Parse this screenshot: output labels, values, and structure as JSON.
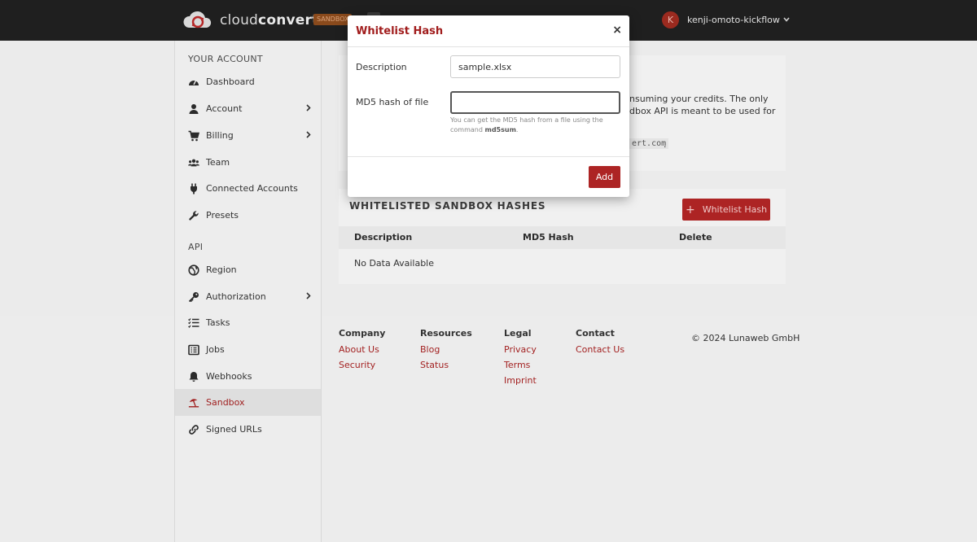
{
  "navbar": {
    "brand_light": "cloud",
    "brand_bold": "convert",
    "env_badge": "SANDBOX",
    "user_initial": "K",
    "username": "kenji-omoto-kickflow"
  },
  "sidebar": {
    "account_heading": "YOUR ACCOUNT",
    "account_items": [
      {
        "label": "Dashboard",
        "icon": "dashboard-icon"
      },
      {
        "label": "Account",
        "icon": "user-icon"
      },
      {
        "label": "Billing",
        "icon": "cart-icon"
      },
      {
        "label": "Team",
        "icon": "team-icon"
      },
      {
        "label": "Connected Accounts",
        "icon": "plug-icon"
      },
      {
        "label": "Presets",
        "icon": "wrench-icon"
      }
    ],
    "api_heading": "API",
    "api_items": [
      {
        "label": "Region",
        "icon": "globe-icon"
      },
      {
        "label": "Authorization",
        "icon": "key-icon"
      },
      {
        "label": "Tasks",
        "icon": "tasks-icon"
      },
      {
        "label": "Jobs",
        "icon": "jobs-icon"
      },
      {
        "label": "Webhooks",
        "icon": "bell-icon"
      },
      {
        "label": "Sandbox",
        "icon": "umbrella-beach-icon",
        "active": true
      },
      {
        "label": "Signed URLs",
        "icon": "link-icon"
      }
    ]
  },
  "main": {
    "intro_line1": "nsuming your credits. The only",
    "intro_line2": "dbox API is meant to be used for",
    "intro_code": "ert.com",
    "intro_period": ".",
    "hashes_title": "WHITELISTED SANDBOX HASHES",
    "whitelist_button": "Whitelist Hash",
    "table": {
      "columns": [
        "Description",
        "MD5 Hash",
        "Delete"
      ],
      "empty_text": "No Data Available"
    }
  },
  "footer": {
    "columns": [
      {
        "heading": "Company",
        "links": [
          "About Us",
          "Security"
        ]
      },
      {
        "heading": "Resources",
        "links": [
          "Blog",
          "Status"
        ]
      },
      {
        "heading": "Legal",
        "links": [
          "Privacy",
          "Terms",
          "Imprint"
        ]
      },
      {
        "heading": "Contact",
        "links": [
          "Contact Us"
        ]
      }
    ],
    "copyright": "© 2024 Lunaweb GmbH"
  },
  "modal": {
    "title": "Whitelist Hash",
    "close_glyph": "×",
    "description_label": "Description",
    "description_value": "sample.xlsx",
    "md5_label": "MD5 hash of file",
    "md5_value": "",
    "help_text": "You can get the MD5 hash from a file using the command",
    "help_command": "md5sum",
    "help_period": ".",
    "add_button": "Add"
  },
  "colors": {
    "accent": "#ad2424",
    "navbar_bg": "#1f1f1f"
  }
}
